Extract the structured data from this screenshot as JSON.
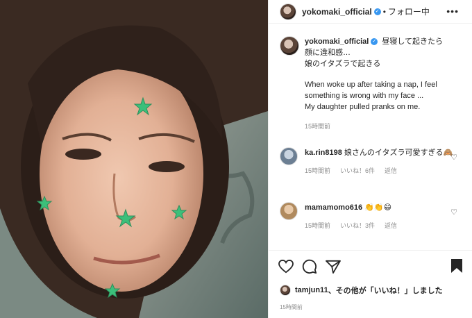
{
  "header": {
    "username": "yokomaki_official",
    "follow_label": "フォロー中",
    "more_label": "•••"
  },
  "caption": {
    "username": "yokomaki_official",
    "line1": "昼寝して起きたら",
    "line2": "顔に違和感…",
    "line3": "娘のイタズラで起きる",
    "en1": "When woke up after taking a nap, I feel",
    "en2": "something is wrong with my face ...",
    "en3": "My daughter pulled pranks on me.",
    "time": "15時間前"
  },
  "comments": [
    {
      "username": "ka.rin8198",
      "text": "娘さんのイタズラ可愛すぎる🙈",
      "time": "15時間前",
      "likes": "いいね！6件",
      "reply": "返信"
    },
    {
      "username": "mamamomo616",
      "text": "👏👏😄",
      "time": "15時間前",
      "likes": "いいね！3件",
      "reply": "返信"
    }
  ],
  "likes": {
    "username": "tamjun11",
    "text": "、その他が「いいね！」しました"
  },
  "post_time": "15時間前",
  "colors": {
    "sticker": "#3cbf7a",
    "verified": "#3897f0"
  }
}
